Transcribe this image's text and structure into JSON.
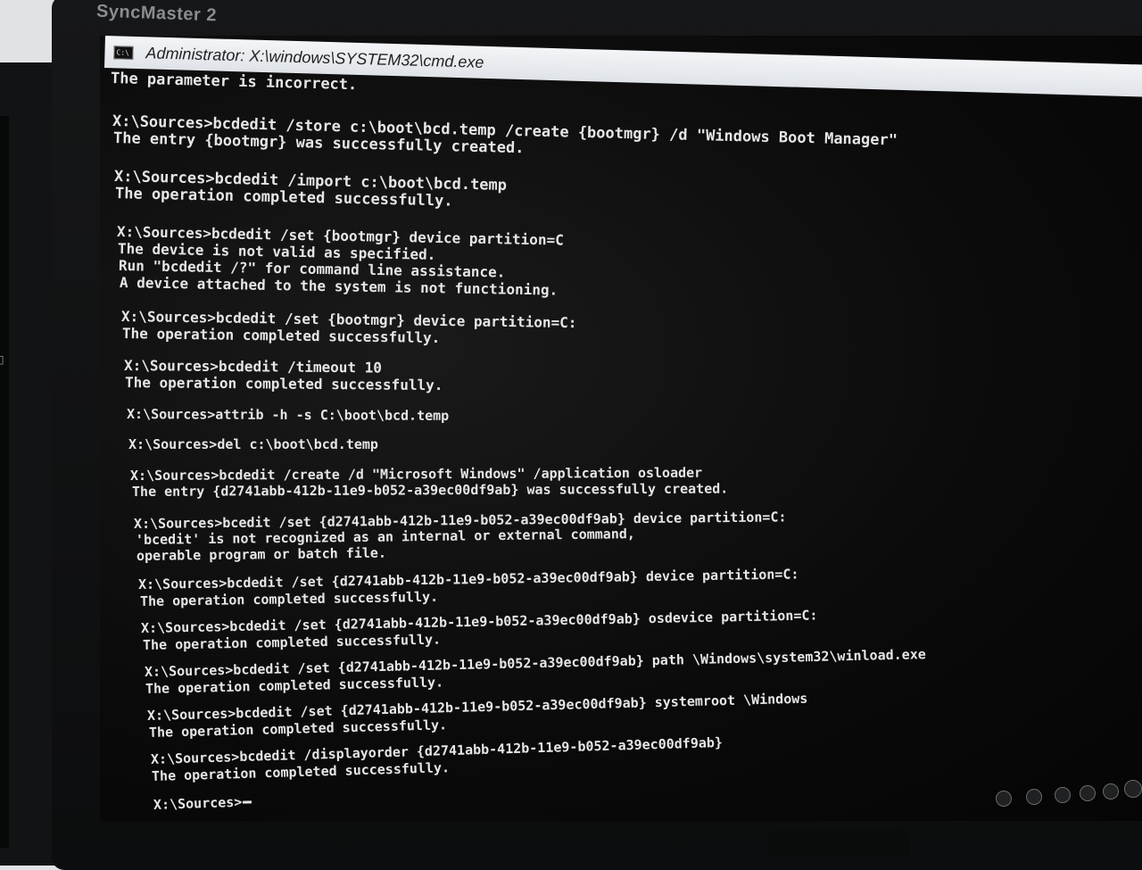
{
  "monitor": {
    "brand": "SyncMaster 2"
  },
  "window": {
    "title": "Administrator: X:\\windows\\SYSTEM32\\cmd.exe",
    "icon": "C:\\",
    "accent_color": "#e6e6e6"
  },
  "console": {
    "lines": [
      "The parameter is incorrect.",
      "X:\\Sources>bcdedit /store c:\\boot\\bcd.temp /create {bootmgr} /d \"Windows Boot Manager\"",
      "The entry {bootmgr} was successfully created.",
      "X:\\Sources>bcdedit /import c:\\boot\\bcd.temp",
      "The operation completed successfully.",
      "X:\\Sources>bcdedit /set {bootmgr} device partition=C",
      "The device is not valid as specified.",
      "Run \"bcdedit /?\" for command line assistance.",
      "A device attached to the system is not functioning.",
      "X:\\Sources>bcdedit /set {bootmgr} device partition=C:",
      "The operation completed successfully.",
      "X:\\Sources>bcdedit /timeout 10",
      "The operation completed successfully.",
      "X:\\Sources>attrib -h -s C:\\boot\\bcd.temp",
      "X:\\Sources>del c:\\boot\\bcd.temp",
      "X:\\Sources>bcdedit /create /d \"Microsoft Windows\" /application osloader",
      "The entry {d2741abb-412b-11e9-b052-a39ec00df9ab} was successfully created.",
      "X:\\Sources>bcedit /set {d2741abb-412b-11e9-b052-a39ec00df9ab} device partition=C:",
      "'bcedit' is not recognized as an internal or external command,",
      "operable program or batch file.",
      "X:\\Sources>bcdedit /set {d2741abb-412b-11e9-b052-a39ec00df9ab} device partition=C:",
      "The operation completed successfully.",
      "X:\\Sources>bcdedit /set {d2741abb-412b-11e9-b052-a39ec00df9ab} osdevice partition=C:",
      "The operation completed successfully.",
      "X:\\Sources>bcdedit /set {d2741abb-412b-11e9-b052-a39ec00df9ab} path \\Windows\\system32\\winload.exe",
      "The operation completed successfully.",
      "X:\\Sources>bcdedit /set {d2741abb-412b-11e9-b052-a39ec00df9ab} systemroot \\Windows",
      "The operation completed successfully.",
      "X:\\Sources>bcdedit /displayorder {d2741abb-412b-11e9-b052-a39ec00df9ab}",
      "The operation completed successfully."
    ],
    "prompt": "X:\\Sources>"
  }
}
